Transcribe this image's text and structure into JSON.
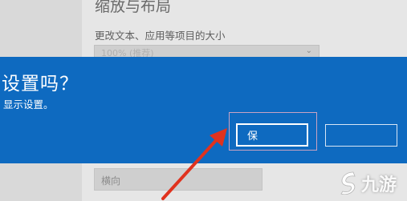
{
  "background_settings": {
    "section_title": "缩放与布局",
    "scale_label": "更改文本、应用等项目的大小",
    "scale_dropdown_value": "100% (推荐)",
    "orientation_value": "横向"
  },
  "dialog": {
    "title": "设置吗？",
    "description": "显示设置。",
    "keep_button_label": "保",
    "revert_button_label": "",
    "background_color": "#0e6ac0"
  },
  "annotation": {
    "arrow_color": "#e0321e",
    "highlight_color": "#c9a3c2"
  },
  "watermark": {
    "text": "九游"
  }
}
